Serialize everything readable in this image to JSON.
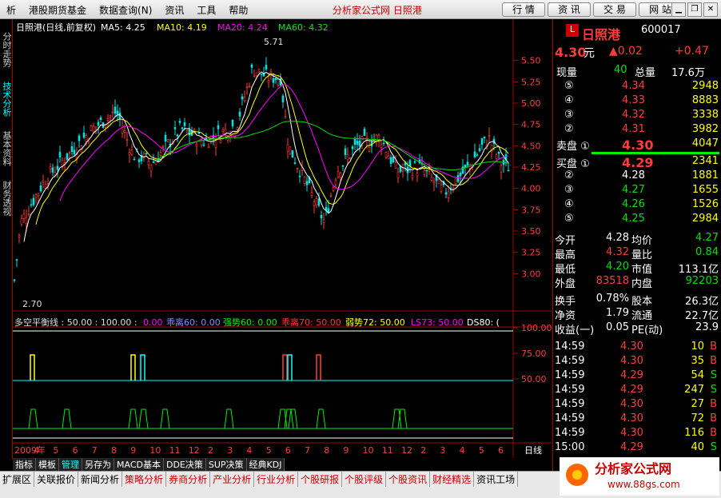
{
  "menu": [
    "析",
    "港股期货基金",
    "数据查询(N)",
    "资讯",
    "工具",
    "帮助"
  ],
  "app_title": "分析家公式网 日照港",
  "top_buttons": [
    "行 情",
    "资 讯",
    "交 易",
    "网 站"
  ],
  "left_tabs": [
    "分时走势",
    "技术分析",
    "基本资料",
    "财务透视"
  ],
  "ma_line": {
    "name": "日照港(日线,前复权)",
    "ma5": "MA5: 4.25",
    "ma10": "MA10: 4.19",
    "ma20": "MA20: 4.24",
    "ma60": "MA60: 4.32"
  },
  "price_ticks": [
    "5.50",
    "5.25",
    "5.00",
    "4.75",
    "4.50",
    "4.25",
    "4.00",
    "3.75",
    "3.50",
    "3.25",
    "3.00"
  ],
  "high_label": "5.71",
  "low_label": "2.70",
  "ind_header": {
    "t1": "多空平衡线 : 50.00 : 100.00 :",
    "t2": "0.00",
    "t3": "乖离60: 0.00",
    "t4": "强势60: 0.00",
    "t5": "乖离70: 50.00",
    "t6": "弱势72: 50.00",
    "t7": "LS73: 50.00",
    "t8": "DS80: ("
  },
  "ind_ticks": [
    "100.00",
    "75.00",
    "50.00"
  ],
  "x_labels": [
    "2009年",
    "4",
    "5",
    "6",
    "7",
    "8",
    "9",
    "10",
    "11",
    "12",
    "2",
    "3",
    "4",
    "5",
    "6",
    "7",
    "8",
    "9",
    "10",
    "11",
    "12",
    "2",
    "3",
    "4",
    "5",
    "6"
  ],
  "period": "日线",
  "chart_tabs": [
    "指标",
    "模板",
    "管理",
    "另存为",
    "MACD基本",
    "DDE决策",
    "SUP决策",
    "经典KDJ"
  ],
  "bottom_tabs": [
    "扩展区",
    "关联报价",
    "新闻分析",
    "策略分析",
    "券商分析",
    "产业分析",
    "行业分析",
    "个股研报",
    "个股评级",
    "个股资讯",
    "财经精选",
    "资讯工场"
  ],
  "stock": {
    "name": "日照港",
    "code": "600017",
    "price": "4.30",
    "unit": "元",
    "change": "▲0.02",
    "pct": "+0.47"
  },
  "vol": {
    "l1": "现量",
    "v1": "40",
    "l2": "总量",
    "v2": "17.6万"
  },
  "sells": [
    [
      "⑤",
      "4.34",
      "2948"
    ],
    [
      "④",
      "4.33",
      "8883"
    ],
    [
      "③",
      "4.32",
      "3338"
    ],
    [
      "②",
      "4.31",
      "3982"
    ],
    [
      "卖盘 ①",
      "4.30",
      "4047"
    ]
  ],
  "buys": [
    [
      "买盘 ①",
      "4.29",
      "2341"
    ],
    [
      "②",
      "4.28",
      "1881"
    ],
    [
      "③",
      "4.27",
      "1655"
    ],
    [
      "④",
      "4.26",
      "1526"
    ],
    [
      "⑤",
      "4.25",
      "2984"
    ]
  ],
  "stats": [
    [
      "今开",
      "4.28",
      "均价",
      "4.27"
    ],
    [
      "最高",
      "4.32",
      "量比",
      "0.84"
    ],
    [
      "最低",
      "4.20",
      "市值",
      "113.1亿"
    ],
    [
      "外盘",
      "83518",
      "内盘",
      "92203"
    ],
    [
      "换手",
      "0.78%",
      "股本",
      "26.3亿"
    ],
    [
      "净资",
      "1.79",
      "流通",
      "22.7亿"
    ],
    [
      "收益(一)",
      "0.05",
      "PE(动)",
      "23.9"
    ]
  ],
  "ticks": [
    [
      "14:59",
      "4.30",
      "10",
      "B"
    ],
    [
      "14:59",
      "4.30",
      "35",
      "B"
    ],
    [
      "14:59",
      "4.29",
      "54",
      "S"
    ],
    [
      "14:59",
      "4.29",
      "247",
      "S"
    ],
    [
      "14:59",
      "4.30",
      "27",
      "B"
    ],
    [
      "14:59",
      "4.30",
      "72",
      "B"
    ],
    [
      "14:59",
      "4.30",
      "116",
      "B"
    ],
    [
      "15:00",
      "4.29",
      "40",
      "S"
    ]
  ],
  "logo": {
    "text": "分析家公式网",
    "url": "www.88gs.com"
  },
  "colors": {
    "up": "#ff3c3c",
    "down": "#00e0e0",
    "ma5": "#ffffff",
    "ma10": "#ffff00",
    "ma20": "#ff00ff",
    "ma60": "#00e000"
  }
}
